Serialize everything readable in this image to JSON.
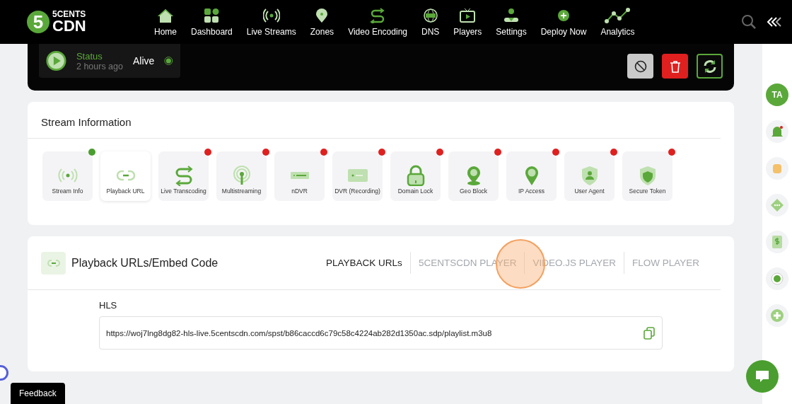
{
  "logo": {
    "badge": "5",
    "top": "5CENTS",
    "bottom": "CDN"
  },
  "nav": [
    {
      "label": "Home",
      "kind": "home"
    },
    {
      "label": "Dashboard",
      "kind": "grid"
    },
    {
      "label": "Live Streams",
      "kind": "broadcast"
    },
    {
      "label": "Zones",
      "kind": "pin"
    },
    {
      "label": "Video Encoding",
      "kind": "encode"
    },
    {
      "label": "DNS",
      "kind": "globe"
    },
    {
      "label": "Players",
      "kind": "tv"
    },
    {
      "label": "Settings",
      "kind": "person"
    },
    {
      "label": "Deploy Now",
      "kind": "plus"
    },
    {
      "label": "Analytics",
      "kind": "chart"
    }
  ],
  "status": {
    "label": "Status",
    "time": "2 hours ago",
    "state": "Alive",
    "alive": true
  },
  "stream_info": {
    "title": "Stream Information",
    "features": [
      {
        "label": "Stream Info",
        "kind": "broadcast",
        "selected": false,
        "color": "#4a9e2f"
      },
      {
        "label": "Playback URL",
        "kind": "link",
        "selected": true
      },
      {
        "label": "Live Transcoding",
        "kind": "encode",
        "selected": false,
        "color": "#e0201f"
      },
      {
        "label": "Multistreaming",
        "kind": "antenna",
        "selected": false,
        "color": "#e0201f"
      },
      {
        "label": "nDVR",
        "kind": "bar",
        "selected": false,
        "color": "#e0201f"
      },
      {
        "label": "DVR (Recording)",
        "kind": "rec",
        "selected": false,
        "color": "#e0201f"
      },
      {
        "label": "Domain Lock",
        "kind": "lock",
        "selected": false,
        "color": "#e0201f"
      },
      {
        "label": "Geo Block",
        "kind": "geo",
        "selected": false,
        "color": "#e0201f"
      },
      {
        "label": "IP Access",
        "kind": "ip",
        "selected": false,
        "color": "#e0201f"
      },
      {
        "label": "User Agent",
        "kind": "user",
        "selected": false,
        "color": "#e0201f"
      },
      {
        "label": "Secure Token",
        "kind": "shield",
        "selected": false,
        "color": "#e0201f"
      }
    ]
  },
  "playback": {
    "title": "Playback URLs/Embed Code",
    "tabs": [
      {
        "label": "PLAYBACK URLs",
        "selected": true
      },
      {
        "label": "5CENTSCDN PLAYER",
        "selected": false
      },
      {
        "label": "VIDEO.JS PLAYER",
        "selected": false
      },
      {
        "label": "FLOW PLAYER",
        "selected": false
      }
    ],
    "field_label": "HLS",
    "url": "https://woj7lng8dg82-hls-live.5centscdn.com/spst/b86caccd6c79c58c4224ab282d1350ac.sdp/playlist.m3u8"
  },
  "avatar": "TA",
  "feedback": "Feedback"
}
